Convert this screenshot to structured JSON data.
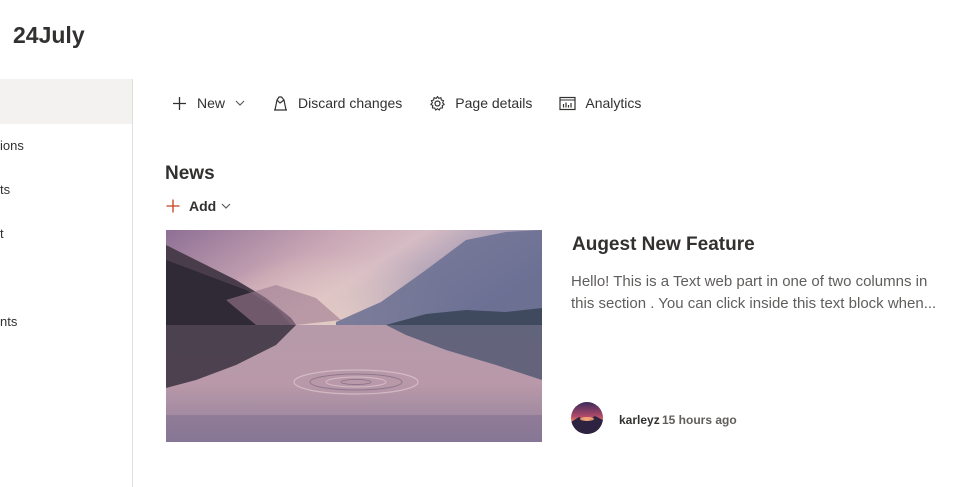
{
  "site": {
    "title": "24July"
  },
  "leftnav": {
    "items": [
      {
        "label": "ions"
      },
      {
        "label": "ts"
      },
      {
        "label": "t"
      },
      {
        "label": "nts"
      }
    ]
  },
  "commandbar": {
    "new_label": "New",
    "discard_label": "Discard changes",
    "page_details_label": "Page details",
    "analytics_label": "Analytics"
  },
  "news": {
    "title": "News",
    "add_label": "Add",
    "article": {
      "title": "Augest New Feature",
      "description_line1": "Hello! This is a Text web part in one of two columns in",
      "description_line2": "this section . You can click inside this text block when...",
      "author": "karleyz",
      "time": "15 hours ago"
    }
  },
  "colors": {
    "accent": "#c43e1c",
    "nav_selected_bg": "#f3f2f1",
    "text": "#323130",
    "subtext": "#605e5c"
  },
  "icons": {
    "new": "plus-icon",
    "discard": "discard-icon",
    "page_details": "gear-icon",
    "analytics": "analytics-icon",
    "add": "plus-icon",
    "dropdown": "chevron-down-icon"
  }
}
